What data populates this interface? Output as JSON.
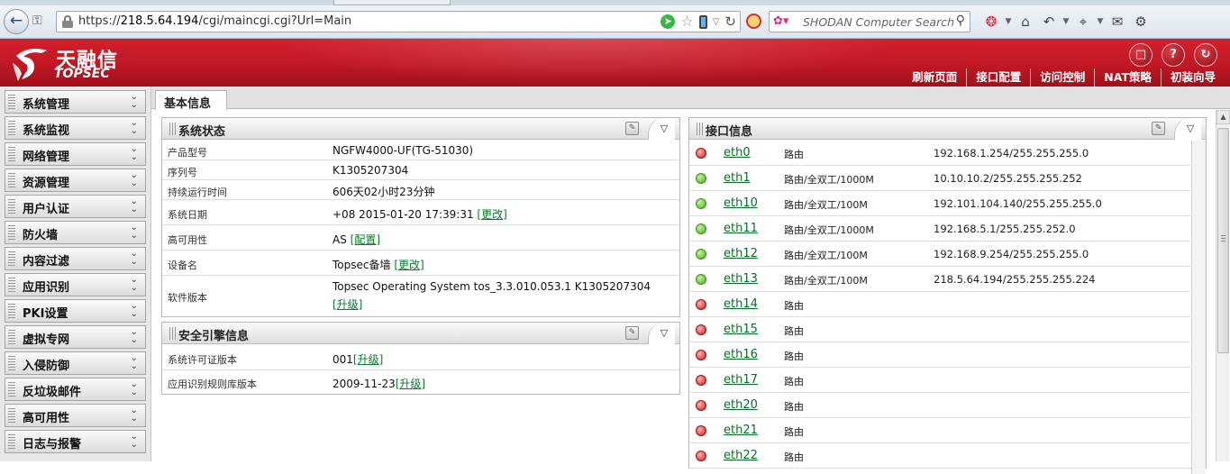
{
  "browser": {
    "url_scheme": "https://",
    "url_host": "218.5.64.194",
    "url_path": "/cgi/maincgi.cgi?Url=Main",
    "search_placeholder": "SHODAN Computer Search ·"
  },
  "header": {
    "logo_cn": "天融信",
    "logo_en": "TOPSEC",
    "top_nav": [
      "刷新页面",
      "接口配置",
      "访问控制",
      "NAT策略",
      "初装向导"
    ],
    "icons": [
      "save-icon",
      "help-icon",
      "logout-icon"
    ]
  },
  "sidebar": {
    "items": [
      {
        "label": "系统管理"
      },
      {
        "label": "系统监视"
      },
      {
        "label": "网络管理"
      },
      {
        "label": "资源管理"
      },
      {
        "label": "用户认证"
      },
      {
        "label": "防火墙"
      },
      {
        "label": "内容过滤"
      },
      {
        "label": "应用识别"
      },
      {
        "label": "PKI设置"
      },
      {
        "label": "虚拟专网"
      },
      {
        "label": "入侵防御"
      },
      {
        "label": "反垃圾邮件"
      },
      {
        "label": "高可用性"
      },
      {
        "label": "日志与报警"
      }
    ]
  },
  "content": {
    "tab_label": "基本信息",
    "system_status": {
      "title": "系统状态",
      "rows": [
        {
          "key": "产品型号",
          "value": "NGFW4000-UF(TG-51030)",
          "link": ""
        },
        {
          "key": "序列号",
          "value": "K1305207304",
          "link": ""
        },
        {
          "key": "持续运行时间",
          "value": "606天02小时23分钟",
          "link": ""
        },
        {
          "key": "系统日期",
          "value": "+08 2015-01-20 17:39:31 ",
          "link": "[更改]"
        },
        {
          "key": "高可用性",
          "value": "AS ",
          "link": "[配置]"
        },
        {
          "key": "设备名",
          "value": "Topsec备墙 ",
          "link": "[更改]"
        },
        {
          "key": "软件版本",
          "value": "Topsec Operating System tos_3.3.010.053.1 K1305207304",
          "link": "[升级]"
        }
      ]
    },
    "security_engine": {
      "title": "安全引擎信息",
      "rows": [
        {
          "key": "系统许可证版本",
          "value": "001",
          "link": "[升级]"
        },
        {
          "key": "应用识别规则库版本",
          "value": "2009-11-23",
          "link": "[升级]"
        }
      ]
    },
    "interfaces": {
      "title": "接口信息",
      "rows": [
        {
          "status": "down",
          "name": "eth0",
          "mode": "路由",
          "ip": "192.168.1.254/255.255.255.0"
        },
        {
          "status": "up",
          "name": "eth1",
          "mode": "路由/全双工/1000M",
          "ip": "10.10.10.2/255.255.255.252"
        },
        {
          "status": "up",
          "name": "eth10",
          "mode": "路由/全双工/100M",
          "ip": "192.101.104.140/255.255.255.0"
        },
        {
          "status": "up",
          "name": "eth11",
          "mode": "路由/全双工/1000M",
          "ip": "192.168.5.1/255.255.252.0"
        },
        {
          "status": "up",
          "name": "eth12",
          "mode": "路由/全双工/100M",
          "ip": "192.168.9.254/255.255.255.0"
        },
        {
          "status": "up",
          "name": "eth13",
          "mode": "路由/全双工/100M",
          "ip": "218.5.64.194/255.255.255.224"
        },
        {
          "status": "down",
          "name": "eth14",
          "mode": "路由",
          "ip": ""
        },
        {
          "status": "down",
          "name": "eth15",
          "mode": "路由",
          "ip": ""
        },
        {
          "status": "down",
          "name": "eth16",
          "mode": "路由",
          "ip": ""
        },
        {
          "status": "down",
          "name": "eth17",
          "mode": "路由",
          "ip": ""
        },
        {
          "status": "down",
          "name": "eth20",
          "mode": "路由",
          "ip": ""
        },
        {
          "status": "down",
          "name": "eth21",
          "mode": "路由",
          "ip": ""
        },
        {
          "status": "down",
          "name": "eth22",
          "mode": "路由",
          "ip": ""
        }
      ]
    }
  },
  "colors": {
    "brand_red": "#c01824",
    "link_green": "#0a7a2b",
    "status_up": "#3fae16",
    "status_down": "#d01818"
  }
}
